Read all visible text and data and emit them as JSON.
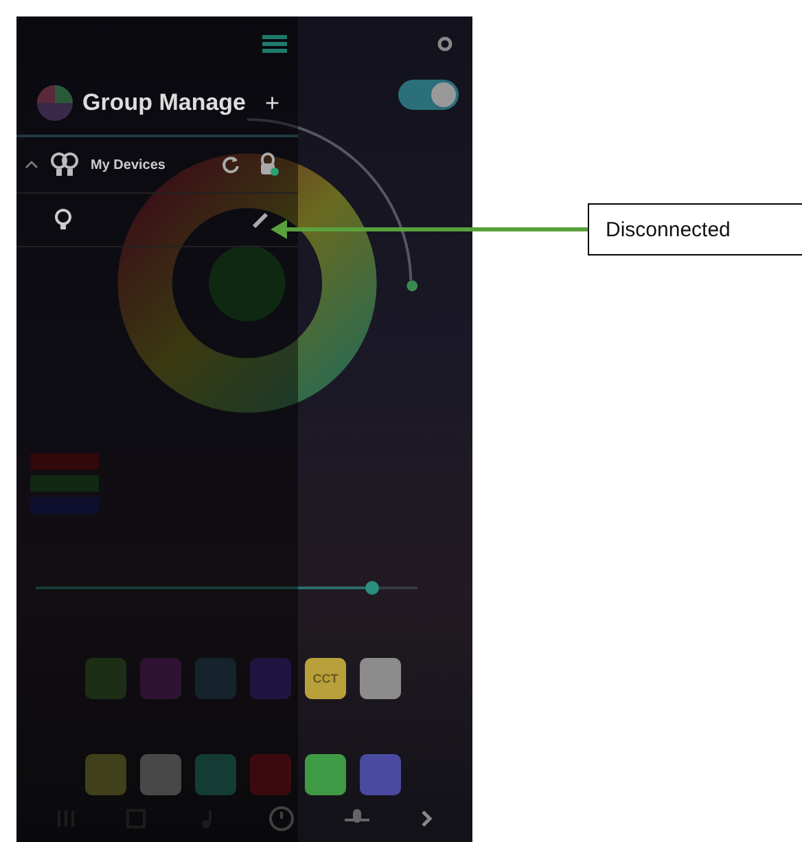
{
  "drawer": {
    "title": "Group Manage",
    "add_button": "+",
    "group": {
      "name": "My Devices",
      "expanded": true
    },
    "devices": [
      {
        "kind": "bulb"
      }
    ]
  },
  "power": {
    "on": true
  },
  "swatch_rows": [
    {
      "swatches": [
        {
          "color": "#1c2e16"
        },
        {
          "color": "#2e1432"
        },
        {
          "color": "#16222c"
        },
        {
          "color": "#1e1640"
        },
        {
          "color": "#b8a13a",
          "label": "CCT"
        },
        {
          "color": "#8c8c8c"
        }
      ]
    },
    {
      "swatches": [
        {
          "color": "#40401a"
        },
        {
          "color": "#484848"
        },
        {
          "color": "#143c34"
        },
        {
          "color": "#3c0a0e"
        },
        {
          "color": "#3f9a45"
        },
        {
          "color": "#4a4aa0"
        }
      ]
    }
  ],
  "brightness": {
    "level": 0.88
  },
  "annotation": {
    "label": "Disconnected"
  }
}
